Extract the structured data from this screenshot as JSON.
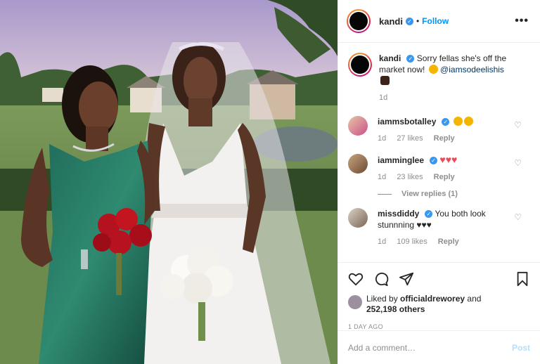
{
  "post": {
    "username": "kandi",
    "follow_label": "Follow",
    "more_label": "•••",
    "caption": {
      "username": "kandi",
      "text": "Sorry fellas she's off the market now!",
      "mention": "@iamsodeelishis",
      "age": "1d"
    },
    "comments": [
      {
        "username": "iammsbotalley",
        "text": "",
        "age": "1d",
        "likes": "27 likes",
        "reply": "Reply"
      },
      {
        "username": "iamminglee",
        "text": "♥♥♥",
        "age": "1d",
        "likes": "23 likes",
        "reply": "Reply"
      },
      {
        "username": "missdiddy",
        "text": "You both look stunnning ♥♥♥",
        "age": "1d",
        "likes": "109 likes",
        "reply": "Reply"
      }
    ],
    "view_replies": "View replies (1)",
    "liked_by_prefix": "Liked by",
    "liked_by_user": "officialdreworey",
    "liked_by_and": "and",
    "liked_by_others": "252,198 others",
    "timestamp": "1 DAY AGO",
    "add_comment_placeholder": "Add a comment…",
    "post_label": "Post"
  },
  "colors": {
    "accent": "#0095f6",
    "verified": "#3897f0",
    "muted": "#8e8e8e"
  }
}
